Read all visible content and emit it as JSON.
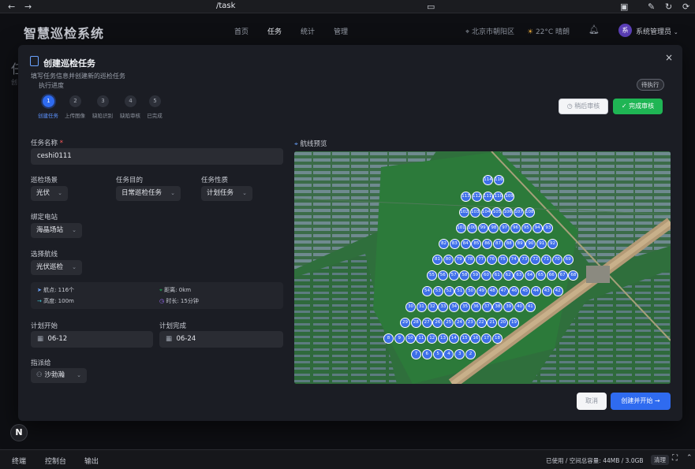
{
  "browser": {
    "back": "←",
    "forward": "→",
    "url": "/task"
  },
  "header": {
    "logo": "智慧巡检系统",
    "nav": [
      "首页",
      "任务",
      "统计",
      "管理"
    ],
    "active_nav": "任务",
    "location": "北京市朝阳区",
    "weather": "22°C 晴朗",
    "avatar_letter": "系",
    "user": "系统管理员"
  },
  "background": {
    "title": "任",
    "subtitle": "创"
  },
  "modal": {
    "title": "创建巡检任务",
    "subtitle": "填写任务信息并创建新的巡检任务",
    "close": "×",
    "progress_label": "执行进度",
    "status_badge": "待执行",
    "steps": [
      {
        "num": "1",
        "label": "创建任务",
        "active": true
      },
      {
        "num": "2",
        "label": "上传图像",
        "active": false
      },
      {
        "num": "3",
        "label": "缺陷识别",
        "active": false
      },
      {
        "num": "4",
        "label": "缺陷审核",
        "active": false
      },
      {
        "num": "5",
        "label": "已完成",
        "active": false
      }
    ],
    "later_review": "稍后审核",
    "complete_review": "完成审核",
    "form": {
      "name_label": "任务名称",
      "name_required": "*",
      "name_value": "ceshi0111",
      "scene_label": "巡检场景",
      "scene_value": "光伏",
      "purpose_label": "任务目的",
      "purpose_value": "日常巡检任务",
      "nature_label": "任务性质",
      "nature_value": "计划任务",
      "station_label": "绑定电站",
      "station_value": "海晶场站",
      "route_label": "选择航线",
      "route_value": "光伏巡检",
      "info": {
        "points": "航点: 116个",
        "distance": "距离: 0km",
        "height": "高度: 100m",
        "duration": "时长: 15分钟"
      },
      "start_label": "计划开始",
      "start_value": "06-12",
      "end_label": "计划完成",
      "end_value": "06-24",
      "assignee_label": "指派给",
      "assignee_value": "沙勃瀚"
    },
    "map_label": "航线预览",
    "cancel": "取消",
    "create": "创建并开始"
  },
  "waypoint_rows": [
    [
      "114",
      "116"
    ],
    [
      "113",
      "112",
      "111",
      "110",
      "109"
    ],
    [
      "102",
      "103",
      "104",
      "105",
      "106",
      "107",
      "108"
    ],
    [
      "101",
      "100",
      "99",
      "98",
      "97",
      "96",
      "95",
      "94",
      "93"
    ],
    [
      "82",
      "83",
      "84",
      "85",
      "86",
      "87",
      "88",
      "89",
      "90",
      "91",
      "92"
    ],
    [
      "81",
      "80",
      "79",
      "78",
      "77",
      "76",
      "75",
      "74",
      "73",
      "72",
      "71",
      "70",
      "69"
    ],
    [
      "55",
      "56",
      "57",
      "58",
      "59",
      "60",
      "61",
      "62",
      "63",
      "64",
      "65",
      "66",
      "67",
      "68"
    ],
    [
      "54",
      "53",
      "52",
      "51",
      "50",
      "49",
      "48",
      "47",
      "46",
      "45",
      "44",
      "43",
      "42"
    ],
    [
      "30",
      "31",
      "32",
      "33",
      "34",
      "35",
      "36",
      "37",
      "38",
      "39",
      "40",
      "41"
    ],
    [
      "29",
      "28",
      "27",
      "26",
      "25",
      "24",
      "23",
      "22",
      "21",
      "20",
      "19"
    ],
    [
      "8",
      "9",
      "10",
      "11",
      "12",
      "13",
      "14",
      "15",
      "16",
      "17",
      "18"
    ],
    [
      "7",
      "6",
      "5",
      "4",
      "3",
      "2"
    ]
  ],
  "bottom": {
    "tabs": [
      "终端",
      "控制台",
      "输出"
    ],
    "storage": "已使用 / 空间总容量: 44MB / 3.0GB",
    "clear": "清理",
    "n_button": "N"
  },
  "colors": {
    "accent": "#2f6bf0",
    "success": "#1fb554",
    "waypoint": "#3d6fe8"
  }
}
